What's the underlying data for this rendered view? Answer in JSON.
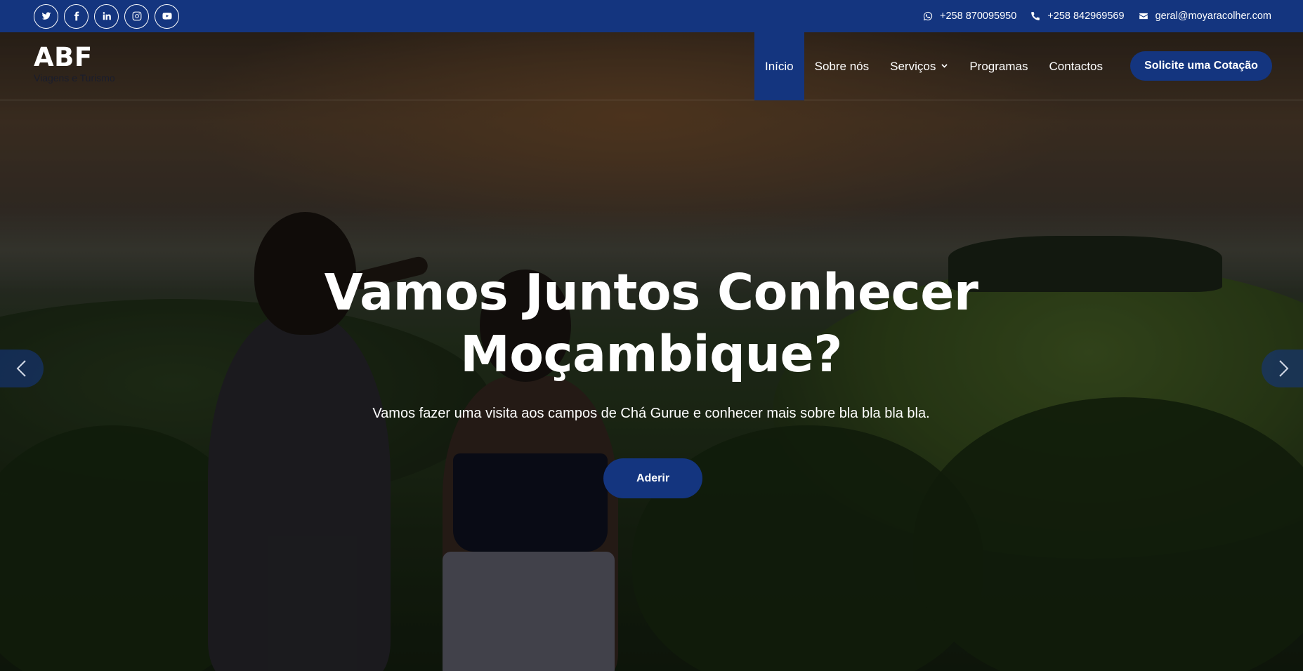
{
  "topbar": {
    "social": [
      {
        "icon": "twitter-icon"
      },
      {
        "icon": "facebook-icon"
      },
      {
        "icon": "linkedin-icon"
      },
      {
        "icon": "instagram-icon"
      },
      {
        "icon": "youtube-icon"
      }
    ],
    "whatsapp": "+258 870095950",
    "phone": "+258 842969569",
    "email": "geral@moyaracolher.com"
  },
  "header": {
    "logo_title": "ABF",
    "logo_subtitle": "Viagens e Turismo",
    "nav": [
      "Início",
      "Sobre nós",
      "Serviços",
      "Programas",
      "Contactos"
    ],
    "cta": "Solicite uma Cotação"
  },
  "hero": {
    "headline_line1": "Vamos Juntos Conhecer",
    "headline_line2": "Moçambique?",
    "subtitle": "Vamos fazer uma visita aos campos de Chá Gurue e conhecer mais sobre bla bla bla bla.",
    "button": "Aderir"
  },
  "colors": {
    "brand": "#14357f",
    "text": "#ffffff"
  }
}
